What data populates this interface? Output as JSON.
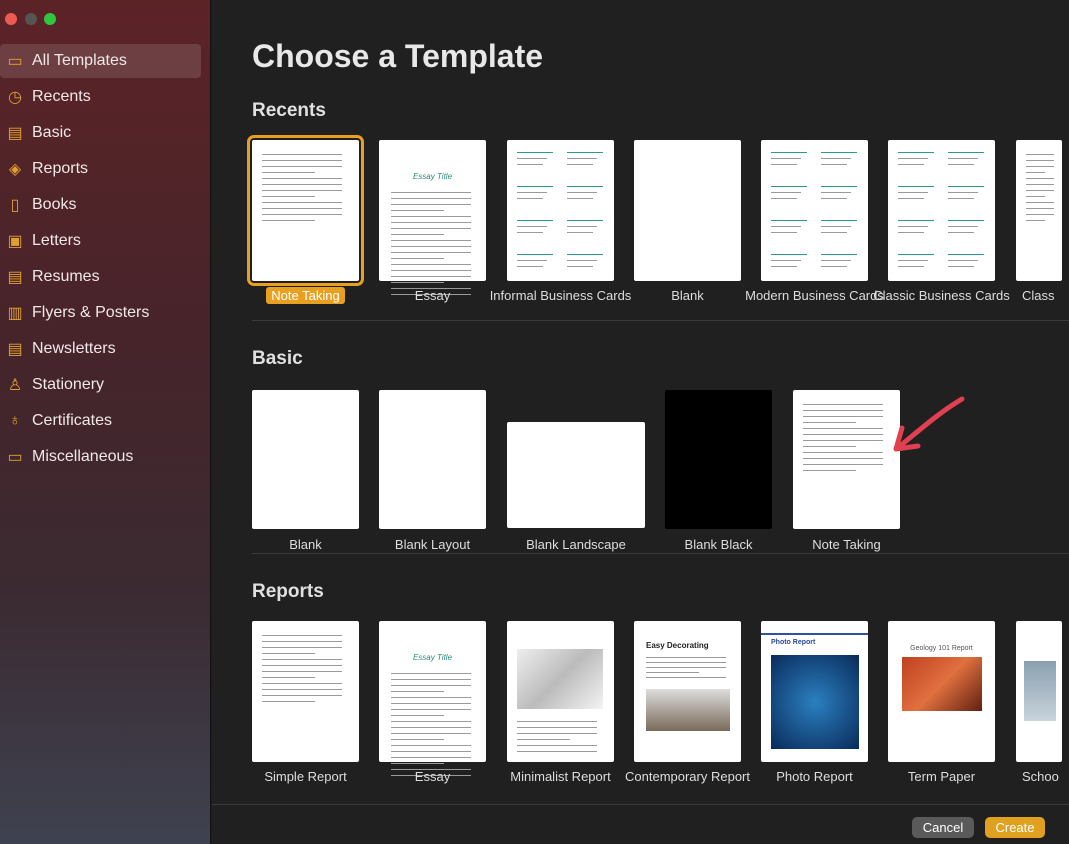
{
  "window": {
    "controls": [
      "close",
      "minimize",
      "zoom"
    ]
  },
  "sidebar": {
    "items": [
      {
        "label": "All Templates",
        "icon": "grid-icon",
        "selected": true
      },
      {
        "label": "Recents",
        "icon": "clock-icon"
      },
      {
        "label": "Basic",
        "icon": "document-icon"
      },
      {
        "label": "Reports",
        "icon": "graduation-cap-icon"
      },
      {
        "label": "Books",
        "icon": "book-icon"
      },
      {
        "label": "Letters",
        "icon": "letter-icon"
      },
      {
        "label": "Resumes",
        "icon": "resume-icon"
      },
      {
        "label": "Flyers & Posters",
        "icon": "flyer-icon"
      },
      {
        "label": "Newsletters",
        "icon": "newsletter-icon"
      },
      {
        "label": "Stationery",
        "icon": "stamp-icon"
      },
      {
        "label": "Certificates",
        "icon": "ribbon-icon"
      },
      {
        "label": "Miscellaneous",
        "icon": "archive-icon"
      }
    ]
  },
  "main": {
    "title": "Choose a Template",
    "sections": [
      {
        "title": "Recents",
        "templates": [
          {
            "label": "Note Taking",
            "selected": true,
            "style": "text"
          },
          {
            "label": "Essay",
            "style": "essay"
          },
          {
            "label": "Informal Business Cards",
            "style": "cards"
          },
          {
            "label": "Blank",
            "style": "blank"
          },
          {
            "label": "Modern Business Cards",
            "style": "cards"
          },
          {
            "label": "Classic Business Cards",
            "style": "cards"
          },
          {
            "label": "Class",
            "style": "text"
          }
        ]
      },
      {
        "title": "Basic",
        "templates": [
          {
            "label": "Blank",
            "style": "blank"
          },
          {
            "label": "Blank Layout",
            "style": "blank"
          },
          {
            "label": "Blank Landscape",
            "style": "landscape"
          },
          {
            "label": "Blank Black",
            "style": "black"
          },
          {
            "label": "Note Taking",
            "style": "text"
          }
        ]
      },
      {
        "title": "Reports",
        "templates": [
          {
            "label": "Simple Report",
            "style": "text"
          },
          {
            "label": "Essay",
            "style": "essay"
          },
          {
            "label": "Minimalist Report",
            "style": "minimal"
          },
          {
            "label": "Contemporary Report",
            "style": "contemporary"
          },
          {
            "label": "Photo Report",
            "style": "photo"
          },
          {
            "label": "Term Paper",
            "style": "term"
          },
          {
            "label": "Schoo",
            "style": "school"
          }
        ]
      }
    ]
  },
  "footer": {
    "cancel": "Cancel",
    "create": "Create"
  },
  "colors": {
    "accent": "#e8a020",
    "annotation_arrow": "#e04050"
  }
}
